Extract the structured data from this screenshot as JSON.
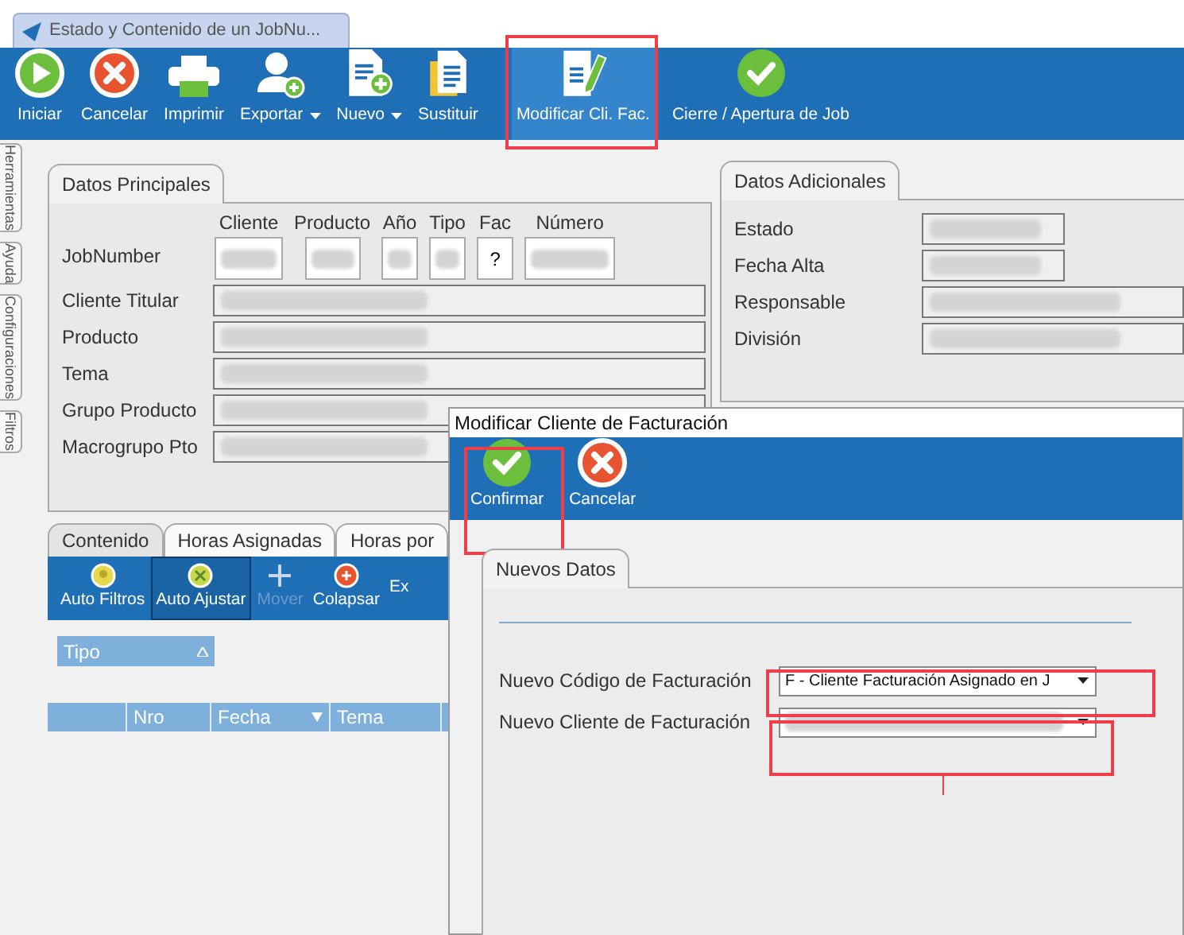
{
  "document_tab": {
    "title": "Estado y Contenido de un JobNu..."
  },
  "toolbar": [
    {
      "label": "Iniciar",
      "kind": "play",
      "dropdown": false,
      "highlighted": false
    },
    {
      "label": "Cancelar",
      "kind": "cancel",
      "dropdown": false,
      "highlighted": false
    },
    {
      "label": "Imprimir",
      "kind": "print",
      "dropdown": false,
      "highlighted": false
    },
    {
      "label": "Exportar",
      "kind": "user",
      "dropdown": true,
      "highlighted": false
    },
    {
      "label": "Nuevo",
      "kind": "new",
      "dropdown": true,
      "highlighted": false
    },
    {
      "label": "Sustituir",
      "kind": "copy",
      "dropdown": false,
      "highlighted": false
    },
    {
      "label": "Modificar Cli. Fac.",
      "kind": "edit",
      "dropdown": false,
      "highlighted": true
    },
    {
      "label": "Cierre / Apertura de Job",
      "kind": "check",
      "dropdown": false,
      "highlighted": false
    }
  ],
  "side_tabs": [
    "Herramientas",
    "Ayuda",
    "Configuraciones",
    "Filtros"
  ],
  "datos_principales": {
    "title": "Datos Principales",
    "jobnumber_label": "JobNumber",
    "code_fields": [
      {
        "header": "Cliente",
        "kind": "redacted"
      },
      {
        "header": "Producto",
        "kind": "redacted"
      },
      {
        "header": "Año",
        "kind": "redacted"
      },
      {
        "header": "Tipo",
        "kind": "redacted"
      },
      {
        "header": "Fac",
        "kind": "text",
        "value": "?"
      },
      {
        "header": "Número",
        "kind": "redacted"
      }
    ],
    "rows": [
      "Cliente Titular",
      "Producto",
      "Tema",
      "Grupo Producto",
      "Macrogrupo Pto"
    ]
  },
  "datos_adicionales": {
    "title": "Datos Adicionales",
    "rows": [
      {
        "label": "Estado",
        "wide": false
      },
      {
        "label": "Fecha Alta",
        "wide": false
      },
      {
        "label": "Responsable",
        "wide": true
      },
      {
        "label": "División",
        "wide": true
      }
    ]
  },
  "content_tabs": [
    {
      "label": "Contenido",
      "selected": true
    },
    {
      "label": "Horas Asignadas",
      "selected": false
    },
    {
      "label": "Horas por",
      "selected": false
    }
  ],
  "content_toolbar": [
    {
      "label": "Auto Filtros",
      "kind": "filter",
      "selected": false,
      "disabled": false
    },
    {
      "label": "Auto Ajustar",
      "kind": "fit",
      "selected": true,
      "disabled": false
    },
    {
      "label": "Mover",
      "kind": "move",
      "selected": false,
      "disabled": true
    },
    {
      "label": "Colapsar",
      "kind": "collapse",
      "selected": false,
      "disabled": false
    },
    {
      "label": "Ex",
      "kind": "none",
      "selected": false,
      "disabled": false
    }
  ],
  "group_header": "Tipo",
  "grid_columns": [
    {
      "filter": false
    },
    {
      "label": "Nro",
      "filter": false
    },
    {
      "label": "Fecha",
      "filter": true
    },
    {
      "label": "Tema",
      "filter": false
    }
  ],
  "dialog": {
    "title": "Modificar Cliente de Facturación",
    "toolbar": [
      {
        "label": "Confirmar",
        "kind": "check"
      },
      {
        "label": "Cancelar",
        "kind": "cancel"
      }
    ],
    "tab": "Nuevos Datos",
    "fields": [
      {
        "label": "Nuevo Código de Facturación",
        "value": "F - Cliente Facturación Asignado en J",
        "redacted": false
      },
      {
        "label": "Nuevo Cliente de Facturación",
        "redacted": true
      }
    ]
  }
}
